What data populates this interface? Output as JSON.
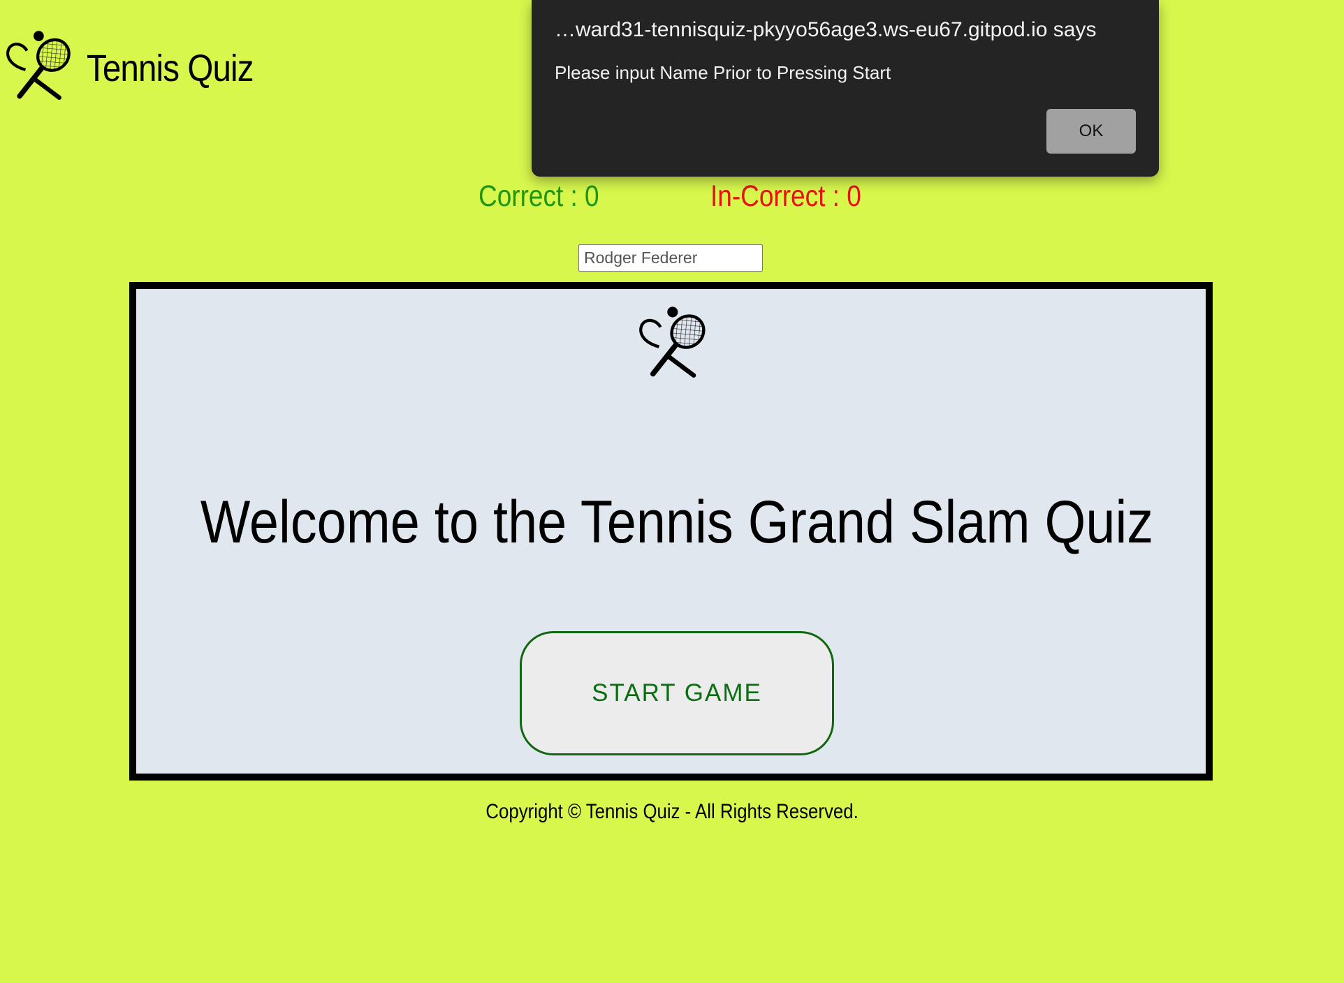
{
  "header": {
    "title": "Tennis Quiz",
    "logo_icon": "tennis-racket-ball-icon"
  },
  "score": {
    "correct_text": "Correct : 0",
    "incorrect_text": "In-Correct : 0",
    "correct_color": "#1e9610",
    "incorrect_color": "#e4140e"
  },
  "name_input": {
    "value": "Rodger Federer"
  },
  "quiz_box": {
    "logo_icon": "tennis-racket-ball-icon",
    "welcome_text": "Welcome to the Tennis Grand Slam Quiz",
    "start_label": "START GAME"
  },
  "footer": {
    "copyright": "Copyright © Tennis Quiz - All Rights Reserved."
  },
  "alert": {
    "origin": "…ward31-tennisquiz-pkyyo56age3.ws-eu67.gitpod.io says",
    "message": "Please input Name Prior to Pressing Start",
    "ok_label": "OK"
  },
  "colors": {
    "background": "#d7f74d",
    "quiz_box_bg": "#e0e7ef",
    "start_text": "#0b6e13",
    "alert_bg": "#242424"
  }
}
